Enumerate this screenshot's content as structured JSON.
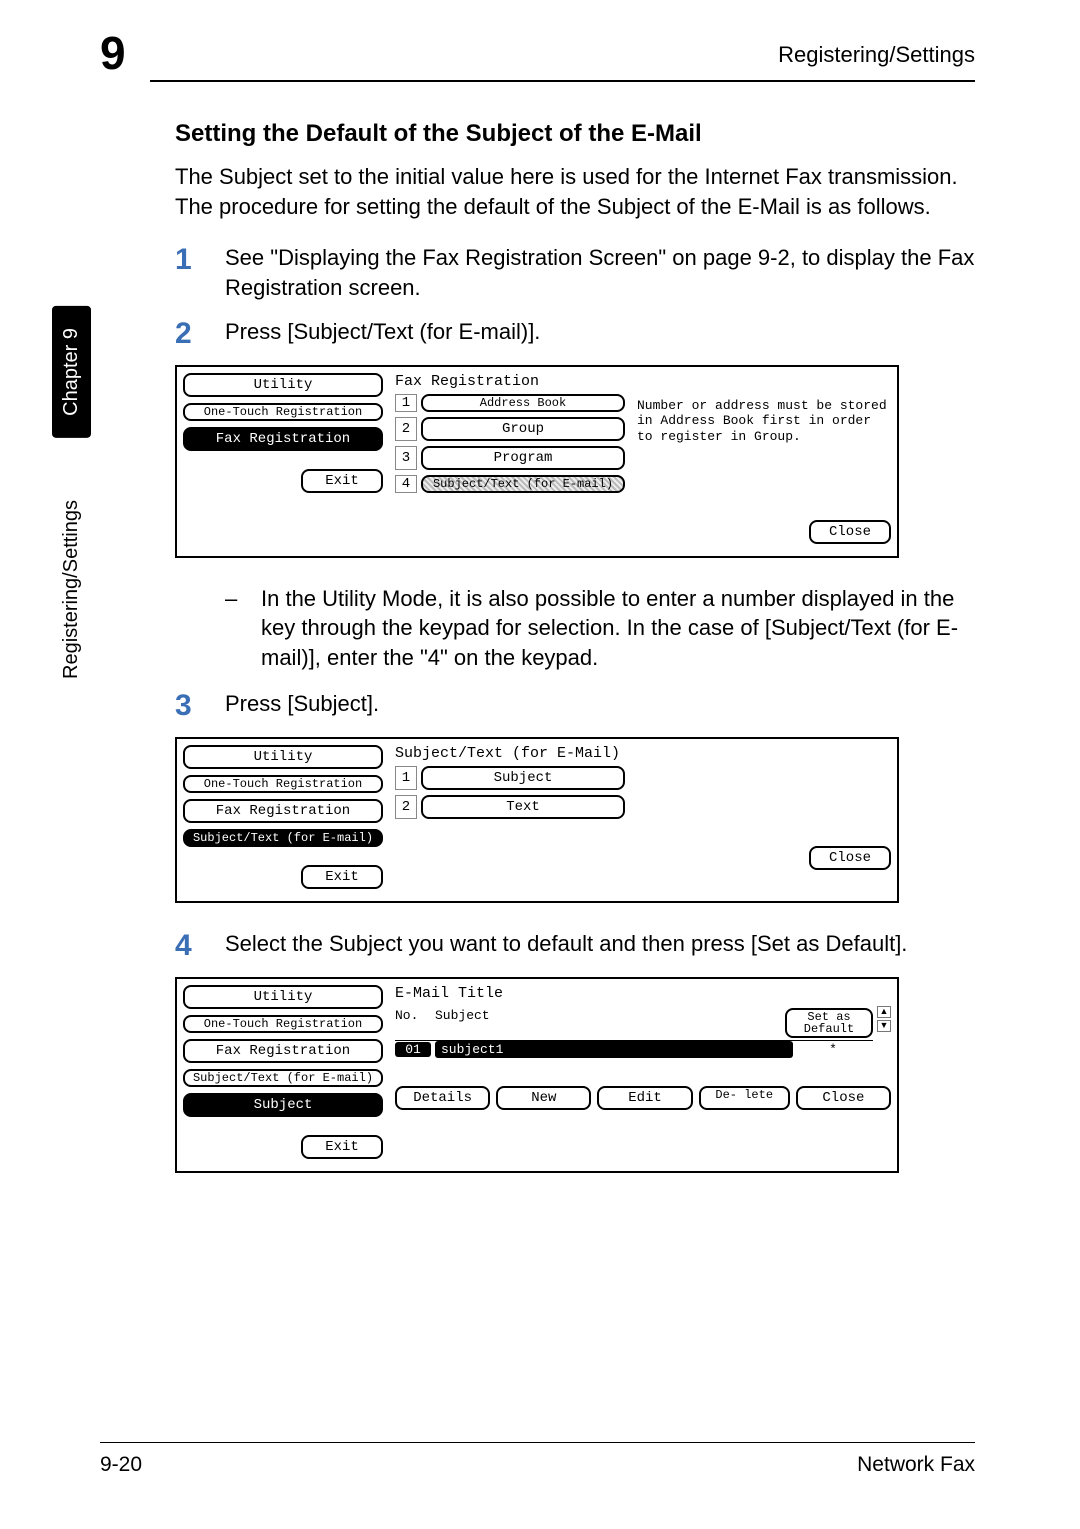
{
  "header": {
    "chapter_number": "9",
    "right_title": "Registering/Settings"
  },
  "side": {
    "chapter_tab": "Chapter 9",
    "section_tab": "Registering/Settings"
  },
  "heading": "Setting the Default of the Subject of the E-Mail",
  "intro": "The Subject set to the initial value here is used for the Internet Fax transmission. The procedure for setting the default of the Subject of the E-Mail is as follows.",
  "steps": {
    "s1": "See \"Displaying the Fax Registration Screen\" on page 9-2, to display the Fax Registration screen.",
    "s2": "Press [Subject/Text (for E-mail)].",
    "s2_note": "In the Utility Mode, it is also possible to enter a number displayed in the key through the keypad for selection. In the case of [Subject/Text (for E-mail)], enter the \"4\" on the keypad.",
    "s3": "Press [Subject].",
    "s4": "Select the Subject you want to default and then press [Set as Default]."
  },
  "panel1": {
    "side": {
      "utility": "Utility",
      "onetouch": "One-Touch\nRegistration",
      "faxreg": "Fax Registration",
      "exit": "Exit"
    },
    "title": "Fax Registration",
    "items": [
      {
        "n": "1",
        "label": "Address\nBook"
      },
      {
        "n": "2",
        "label": "Group"
      },
      {
        "n": "3",
        "label": "Program"
      },
      {
        "n": "4",
        "label": "Subject/Text\n(for E-mail)"
      }
    ],
    "info": "Number or address must be stored in Address Book first in order to register in Group.",
    "close": "Close"
  },
  "panel2": {
    "side": {
      "utility": "Utility",
      "onetouch": "One-Touch\nRegistration",
      "faxreg": "Fax Registration",
      "subj": "Subject/Text\n(for E-mail)",
      "exit": "Exit"
    },
    "title": "Subject/Text (for E-Mail)",
    "items": [
      {
        "n": "1",
        "label": "Subject"
      },
      {
        "n": "2",
        "label": "Text"
      }
    ],
    "close": "Close"
  },
  "panel3": {
    "side": {
      "utility": "Utility",
      "onetouch": "One-Touch\nRegistration",
      "faxreg": "Fax Registration",
      "subj": "Subject/Text\n(for E-mail)",
      "subject": "Subject",
      "exit": "Exit"
    },
    "title": "E-Mail Title",
    "columns": {
      "no": "No.",
      "subject": "Subject",
      "default": "Set as\nDefault"
    },
    "row": {
      "no": "01",
      "subject": "subject1",
      "mark": "*"
    },
    "actions": {
      "details": "Details",
      "new": "New",
      "edit": "Edit",
      "delete": "De-\nlete",
      "close": "Close"
    }
  },
  "footer": {
    "left": "9-20",
    "right": "Network Fax"
  }
}
